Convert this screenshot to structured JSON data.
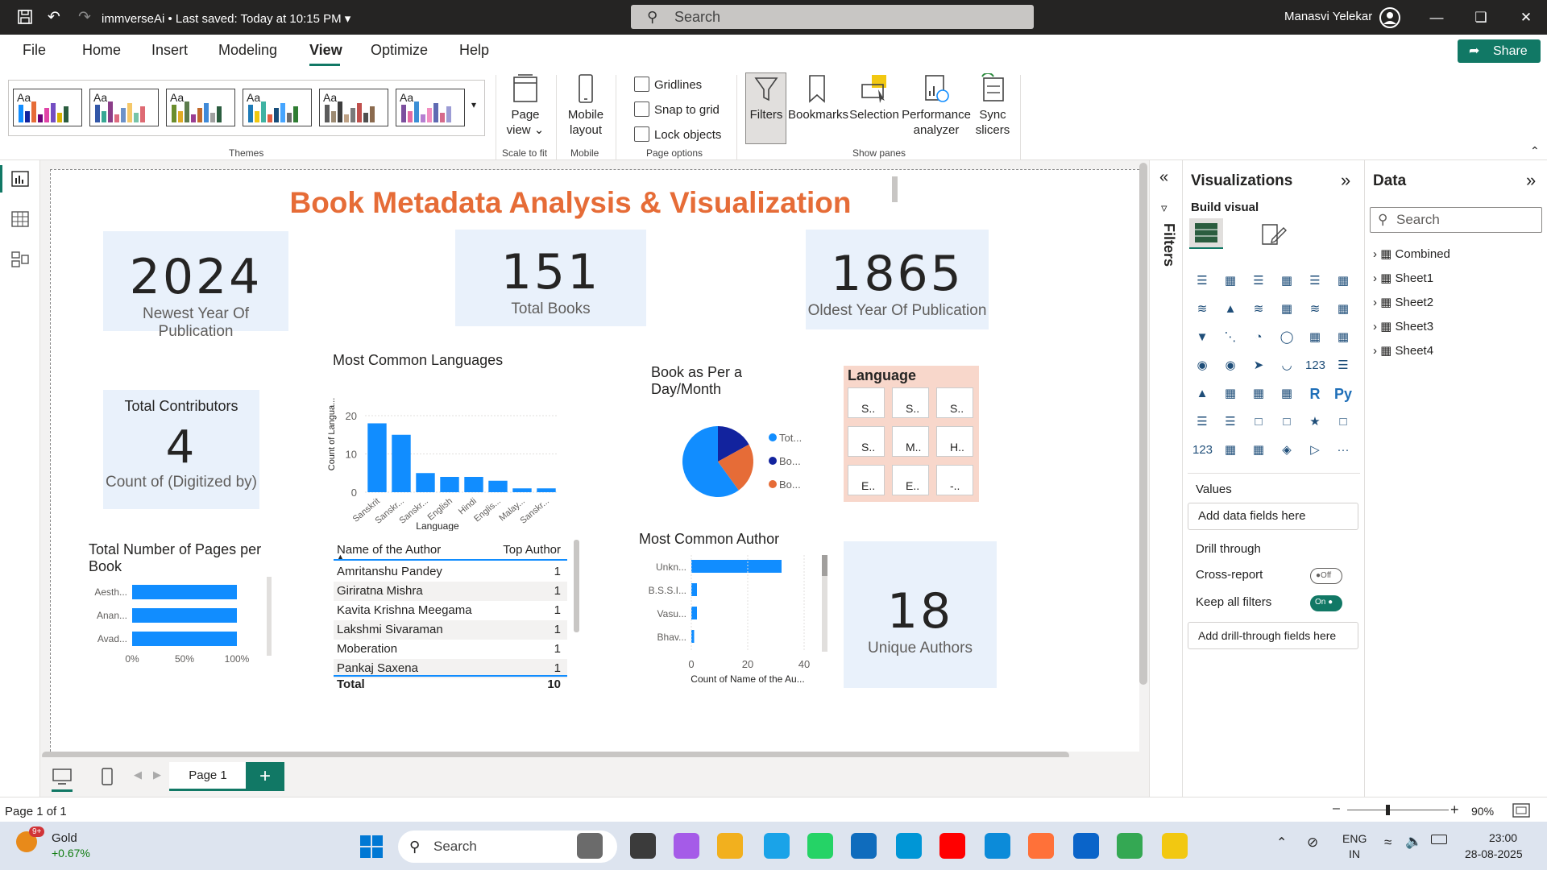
{
  "titlebar": {
    "title": "immverseAi  •  Last saved: Today at 10:15 PM",
    "search_placeholder": "Search",
    "user": "Manasvi Yelekar"
  },
  "menu": {
    "items": [
      "File",
      "Home",
      "Insert",
      "Modeling",
      "View",
      "Optimize",
      "Help"
    ],
    "active": "View",
    "share_label": "Share"
  },
  "ribbon": {
    "themes_label": "Themes",
    "theme_aa": "Aa",
    "page_view_label": "Page view",
    "scale_to_fit_label": "Scale to fit",
    "mobile_layout_label": "Mobile layout",
    "mobile_group_label": "Mobile",
    "gridlines_label": "Gridlines",
    "snap_label": "Snap to grid",
    "lock_label": "Lock objects",
    "page_options_label": "Page options",
    "filters_label": "Filters",
    "bookmarks_label": "Bookmarks",
    "selection_label": "Selection",
    "performance_label": "Performance analyzer",
    "sync_label": "Sync slicers",
    "show_panes_label": "Show panes"
  },
  "report": {
    "title": "Book Metadata Analysis & Visualization",
    "cards": {
      "newest": {
        "value": "2024",
        "label": "Newest Year Of Publication"
      },
      "total_books": {
        "value": "151",
        "label": "Total Books"
      },
      "oldest": {
        "value": "1865",
        "label": "Oldest Year Of Publication"
      },
      "contributors": {
        "title": "Total Contributors",
        "value": "4",
        "label": "Count of (Digitized by)"
      },
      "unique_authors": {
        "value": "18",
        "label": "Unique Authors"
      }
    },
    "languages_chart_title": "Most Common Languages",
    "pie_title": "Book as Per a Day/Month",
    "language_slicer_title": "Language",
    "language_slicer_items": [
      "S..",
      "S..",
      "S..",
      "S..",
      "M..",
      "H..",
      "E..",
      "E..",
      "-.."
    ],
    "pages_chart_title": "Total Number of Pages per Book",
    "author_chart_title": "Most Common Author",
    "author_table": {
      "headers": [
        "Name of the Author",
        "Top Author"
      ],
      "rows": [
        {
          "name": "Amritanshu Pandey",
          "value": "1"
        },
        {
          "name": "Giriratna Mishra",
          "value": "1"
        },
        {
          "name": "Kavita Krishna Meegama",
          "value": "1"
        },
        {
          "name": "Lakshmi Sivaraman",
          "value": "1"
        },
        {
          "name": "Moberation",
          "value": "1"
        },
        {
          "name": "Pankaj Saxena",
          "value": "1"
        }
      ],
      "total_label": "Total",
      "total_value": "10"
    }
  },
  "chart_data": [
    {
      "type": "bar",
      "title": "Most Common Languages",
      "categories": [
        "Sanskrit",
        "Sanskr...",
        "Sanskr...",
        "English",
        "Hindi",
        "Englis...",
        "Malay...",
        "Sanskr..."
      ],
      "values": [
        18,
        15,
        5,
        4,
        4,
        3,
        1,
        1
      ],
      "xlabel": "Language",
      "ylabel": "Count of Langua...",
      "ylim": [
        0,
        20
      ],
      "yticks": [
        0,
        10,
        20
      ],
      "color": "#118dff"
    },
    {
      "type": "pie",
      "title": "Book as Per a Day/Month",
      "labels": [
        "Tot...",
        "Bo...",
        "Bo..."
      ],
      "values": [
        60,
        17,
        23
      ],
      "colors": [
        "#118dff",
        "#12239e",
        "#e66c37"
      ],
      "legend": "right"
    },
    {
      "type": "bar",
      "orientation": "horizontal",
      "title": "Total Number of Pages per Book",
      "categories": [
        "Aesth...",
        "Anan...",
        "Avad..."
      ],
      "values": [
        100,
        100,
        100
      ],
      "xlim": [
        0,
        100
      ],
      "xticks": [
        "0%",
        "50%",
        "100%"
      ],
      "color": "#118dff"
    },
    {
      "type": "bar",
      "orientation": "horizontal",
      "title": "Most Common Author",
      "categories": [
        "Unkn...",
        "B.S.S.I...",
        "Vasu...",
        "Bhav..."
      ],
      "values": [
        32,
        2,
        2,
        1
      ],
      "xlim": [
        0,
        40
      ],
      "xticks": [
        0,
        20,
        40
      ],
      "xlabel": "Count of Name of the Au...",
      "color": "#118dff"
    }
  ],
  "panes": {
    "filters_label": "Filters",
    "viz_title": "Visualizations",
    "build_visual": "Build visual",
    "values_label": "Values",
    "add_data_fields": "Add data fields here",
    "drill_through": "Drill through",
    "cross_report": "Cross-report",
    "cross_report_state": "Off",
    "keep_filters": "Keep all filters",
    "keep_filters_state": "On",
    "add_drill_fields": "Add drill-through fields here",
    "data_title": "Data",
    "data_search": "Search",
    "tables": [
      "Combined",
      "Sheet1",
      "Sheet2",
      "Sheet3",
      "Sheet4"
    ]
  },
  "pagebar": {
    "page_tab": "Page 1"
  },
  "status": {
    "page_count": "Page 1 of 1",
    "zoom": "90%"
  },
  "taskbar": {
    "stock_badge": "9+",
    "stock_name": "Gold",
    "stock_change": "+0.67%",
    "search": "Search",
    "lang1": "ENG",
    "lang2": "IN",
    "time": "23:00",
    "date": "28-08-2025"
  },
  "colors": {
    "accent": "#117865",
    "title_orange": "#e66c37",
    "bar_blue": "#118dff",
    "card_bg": "#e9f1fb",
    "slicer_bg": "#f8d7cb"
  }
}
